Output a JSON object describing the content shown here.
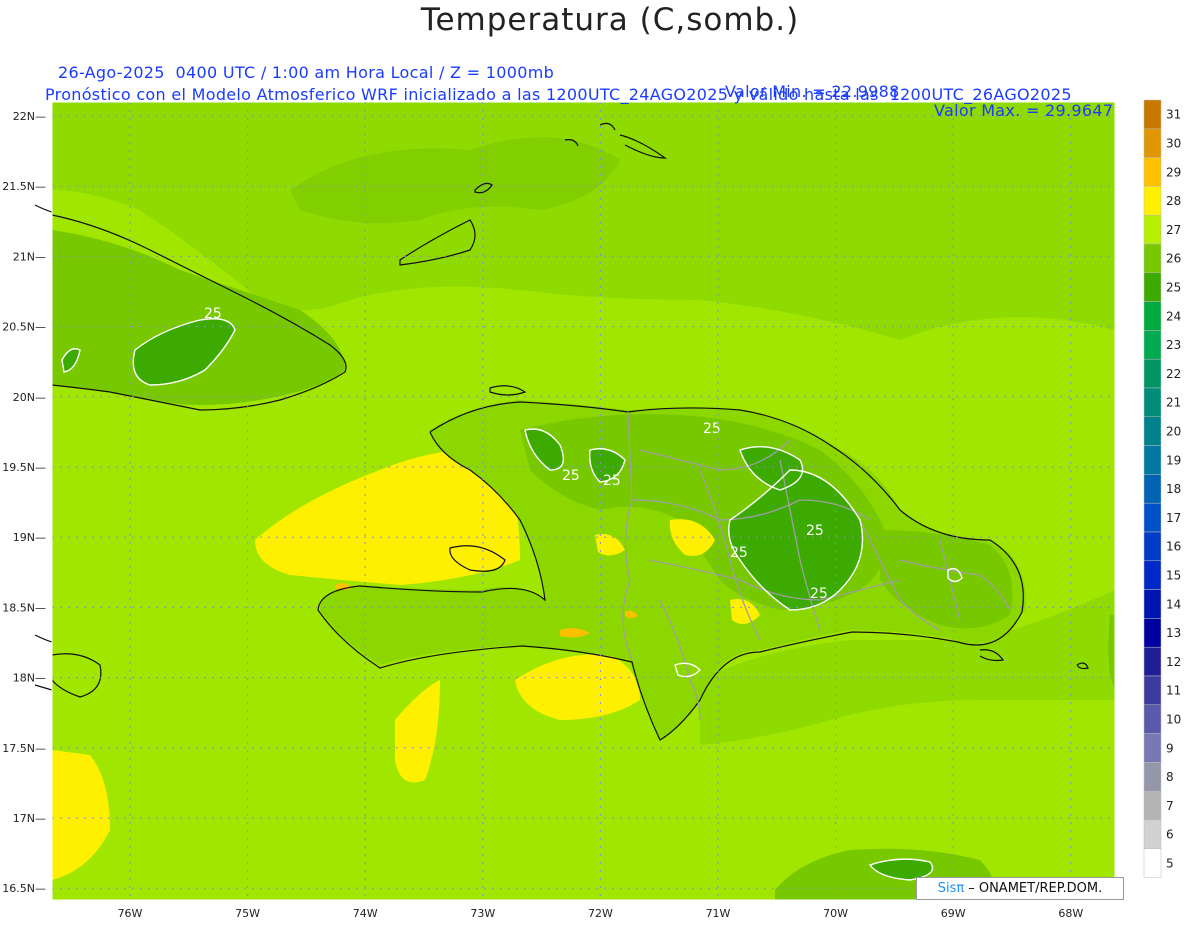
{
  "title": "Temperatura (C,somb.)",
  "subtitle": {
    "datetime": "26-Ago-2025  0400 UTC / 1:00 am Hora Local / Z = 1000mb",
    "min": "Valor Min. = 22.9988",
    "max": "Valor Max. = 29.9647",
    "model": "Pronóstico con el Modelo Atmosferico WRF inicializado a las 1200UTC_24AGO2025 y válido hasta las  1200UTC_26AGO2025"
  },
  "credit": {
    "brand": "Sisπ",
    "org": "– ONAMET/REP.DOM."
  },
  "axes": {
    "lat_labels": [
      "22N",
      "21.5N",
      "21N",
      "20.5N",
      "20N",
      "19.5N",
      "19N",
      "18.5N",
      "18N",
      "17.5N",
      "17N",
      "16.5N"
    ],
    "lon_labels": [
      "76W",
      "75W",
      "74W",
      "73W",
      "72W",
      "71W",
      "70W",
      "69W",
      "68W"
    ]
  },
  "contour_labels": [
    "25",
    "25",
    "25",
    "25",
    "25",
    "25",
    "25"
  ],
  "colorbar": {
    "labels": [
      "31",
      "30",
      "29",
      "28",
      "27",
      "26",
      "25",
      "24",
      "23",
      "22",
      "21",
      "20",
      "19",
      "18",
      "17",
      "16",
      "15",
      "14",
      "13",
      "12",
      "11",
      "10",
      "9",
      "8",
      "7",
      "6",
      "5"
    ],
    "colors": [
      "#c87800",
      "#e09600",
      "#ffc000",
      "#fff000",
      "#b4f000",
      "#78c800",
      "#3caa00",
      "#00aa3c",
      "#00aa50",
      "#009664",
      "#008c78",
      "#00828c",
      "#0078a0",
      "#0064b4",
      "#0050c8",
      "#003cc8",
      "#0028c8",
      "#0014b4",
      "#0000a0",
      "#1e1e96",
      "#3c3ca0",
      "#5a5aaa",
      "#7878b4",
      "#9696aa",
      "#b4b4b4",
      "#d2d2d2",
      "#ffffff"
    ]
  },
  "palette": {
    "sea_main": "#a0e600",
    "sea_light": "#b4f000",
    "north_band": "#8cd700",
    "yellow": "#fff000",
    "land_dark": "#78c800",
    "land_mid": "#8cd700",
    "cold_green": "#3caa00",
    "orange": "#ffc000",
    "grid": "#8a8adc",
    "coast": "#111111",
    "border": "#a0a0a0"
  }
}
